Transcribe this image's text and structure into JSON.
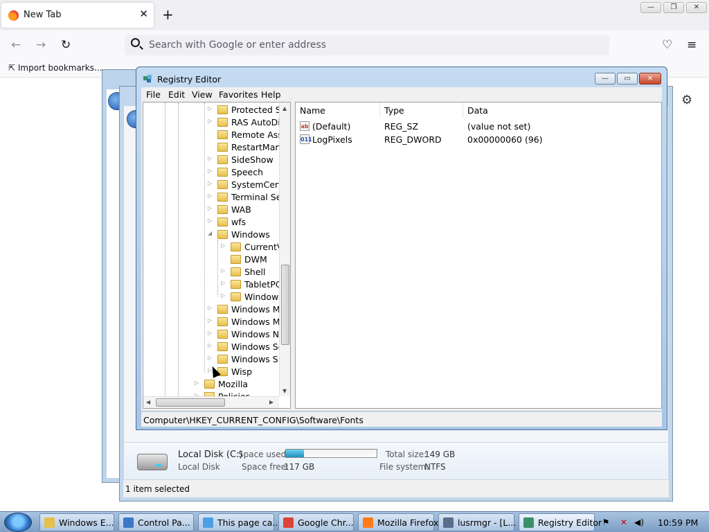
{
  "browser": {
    "tab_title": "New Tab",
    "tab_close": "✕",
    "new_tab": "+",
    "url_placeholder": "Search with Google or enter address",
    "bookmark_import": "Import bookmarks...",
    "win_min": "—",
    "win_restore": "❐",
    "win_close": "✕"
  },
  "regedit": {
    "title": "Registry Editor",
    "menu": [
      "File",
      "Edit",
      "View",
      "Favorites",
      "Help"
    ],
    "tree_nodes": [
      {
        "label": "Protected Stor",
        "expander": "▷"
      },
      {
        "label": "RAS AutoDial",
        "expander": "▷"
      },
      {
        "label": "Remote Assista",
        "expander": ""
      },
      {
        "label": "RestartManage",
        "expander": ""
      },
      {
        "label": "SideShow",
        "expander": "▷"
      },
      {
        "label": "Speech",
        "expander": "▷"
      },
      {
        "label": "SystemCertific",
        "expander": "▷"
      },
      {
        "label": "Terminal Serve",
        "expander": "▷"
      },
      {
        "label": "WAB",
        "expander": "▷"
      },
      {
        "label": "wfs",
        "expander": "▷"
      },
      {
        "label": "Windows",
        "expander": "◢"
      },
      {
        "label": "CurrentVer",
        "expander": "▷"
      },
      {
        "label": "DWM",
        "expander": ""
      },
      {
        "label": "Shell",
        "expander": "▷"
      },
      {
        "label": "TabletPC",
        "expander": "▷"
      },
      {
        "label": "Windows E",
        "expander": "▷"
      },
      {
        "label": "Windows Mail",
        "expander": "▷"
      },
      {
        "label": "Windows Med",
        "expander": "▷"
      },
      {
        "label": "Windows NT",
        "expander": "▷"
      },
      {
        "label": "Windows Sear",
        "expander": "▷"
      },
      {
        "label": "Windows Sidel",
        "expander": "▷"
      },
      {
        "label": "Wisp",
        "expander": "▷"
      },
      {
        "label": "Mozilla",
        "expander": "▷"
      },
      {
        "label": "Policies",
        "expander": "▷"
      }
    ],
    "columns": {
      "name": "Name",
      "type": "Type",
      "data": "Data"
    },
    "values": [
      {
        "icon": "ab",
        "name": "(Default)",
        "type": "REG_SZ",
        "data": "(value not set)"
      },
      {
        "icon": "011",
        "name": "LogPixels",
        "type": "REG_DWORD",
        "data": "0x00000060 (96)"
      }
    ],
    "status_path": "Computer\\HKEY_CURRENT_CONFIG\\Software\\Fonts"
  },
  "explorer": {
    "disk_name": "Local Disk (C:)",
    "disk_type": "Local Disk",
    "space_used_label": "Space used:",
    "space_used_fraction": 0.2,
    "space_free_label": "Space free:",
    "space_free_value": "117 GB",
    "total_size_label": "Total size:",
    "total_size_value": "149 GB",
    "fs_label": "File system:",
    "fs_value": "NTFS",
    "status": "1 item selected"
  },
  "taskbar": {
    "items": [
      {
        "label": "Windows E...",
        "color": "#e7bf4c"
      },
      {
        "label": "Control Pa...",
        "color": "#3c78c8"
      },
      {
        "label": "This page ca...",
        "color": "#4aa0e0"
      },
      {
        "label": "Google Chr...",
        "color": "#db4437"
      },
      {
        "label": "Mozilla Firefox",
        "color": "#ff7a18"
      },
      {
        "label": "lusrmgr - [L...",
        "color": "#5a6e8c"
      },
      {
        "label": "Registry Editor",
        "color": "#3a8f6a"
      }
    ],
    "clock": "10:59 PM"
  }
}
